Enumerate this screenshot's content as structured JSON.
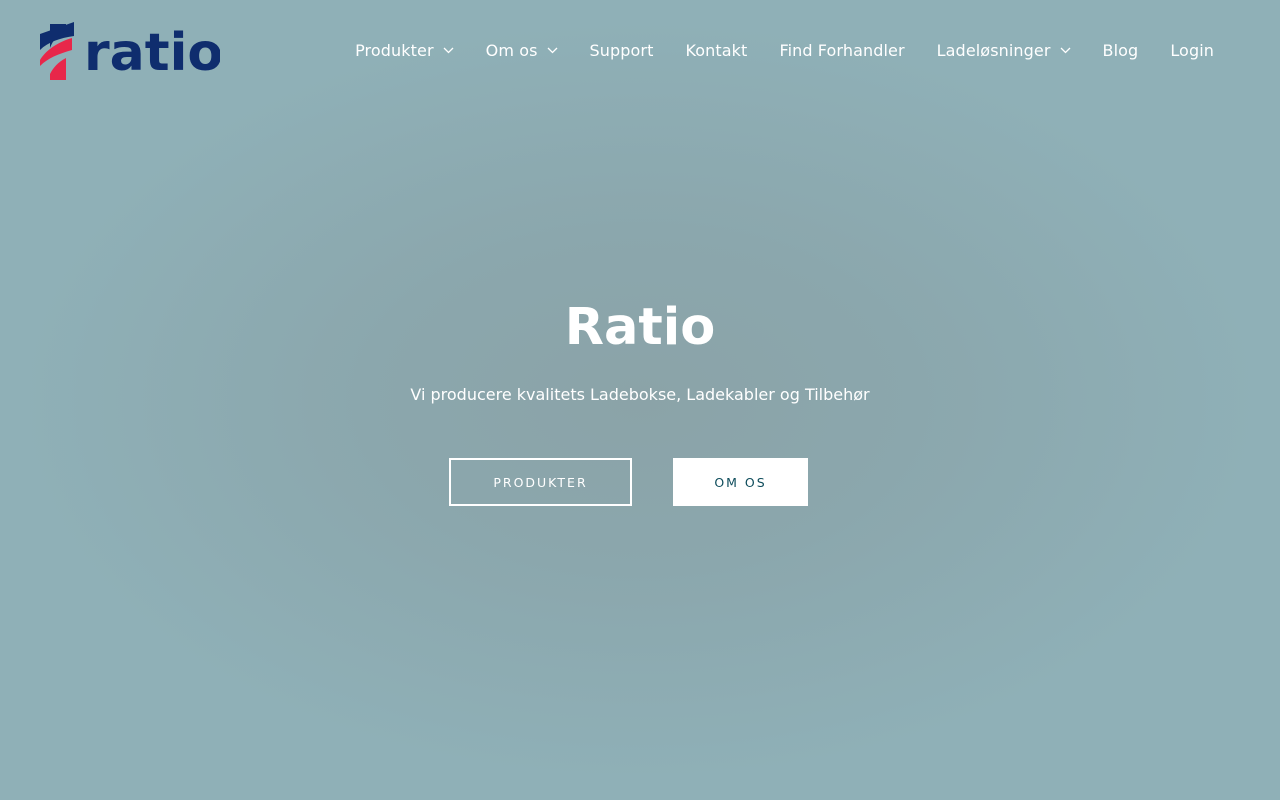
{
  "brand": {
    "logo_text": "ratio",
    "logo_icon": "ratio-logo-mark",
    "colors": {
      "logo_red": "#e8274a",
      "logo_navy": "#0f2d6e",
      "button_text": "#0f4d5c",
      "hero_bg": "#8fb0b7"
    }
  },
  "nav": {
    "items": [
      {
        "label": "Produkter",
        "dropdown": true
      },
      {
        "label": "Om os",
        "dropdown": true
      },
      {
        "label": "Support",
        "dropdown": false
      },
      {
        "label": "Kontakt",
        "dropdown": false
      },
      {
        "label": "Find Forhandler",
        "dropdown": false
      },
      {
        "label": "Ladeløsninger",
        "dropdown": true
      },
      {
        "label": "Blog",
        "dropdown": false
      },
      {
        "label": "Login",
        "dropdown": false
      }
    ]
  },
  "hero": {
    "title": "Ratio",
    "subtitle": "Vi producere kvalitets Ladebokse, Ladekabler og Tilbehør",
    "primary_button": "PRODUKTER",
    "secondary_button": "OM OS"
  }
}
